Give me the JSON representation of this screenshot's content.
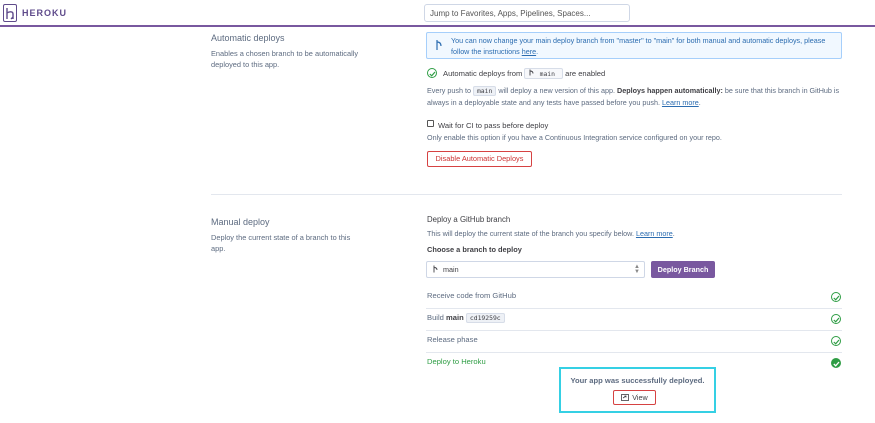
{
  "header": {
    "brand": "HEROKU",
    "search_placeholder": "Jump to Favorites, Apps, Pipelines, Spaces..."
  },
  "auto_deploys": {
    "title": "Automatic deploys",
    "description": "Enables a chosen branch to be automatically deployed to this app.",
    "banner": {
      "text": "You can now change your main deploy branch from \"master\" to \"main\" for both manual and automatic deploys, please follow the instructions",
      "link": "here",
      "end": "."
    },
    "status_prefix": "Automatic deploys from",
    "branch": "main",
    "status_suffix": "are enabled",
    "push_1": "Every push to",
    "push_branch": "main",
    "push_2": "will deploy a new version of this app.",
    "push_bold": "Deploys happen automatically:",
    "push_3": "be sure that this branch in GitHub is always in a deployable state and any tests have passed before you push.",
    "push_link": "Learn more",
    "push_end": ".",
    "ci_label": "Wait for CI to pass before deploy",
    "ci_desc": "Only enable this option if you have a Continuous Integration service configured on your repo.",
    "disable_button": "Disable Automatic Deploys"
  },
  "manual_deploy": {
    "title": "Manual deploy",
    "description": "Deploy the current state of a branch to this app.",
    "heading": "Deploy a GitHub branch",
    "sub": "This will deploy the current state of the branch you specify below.",
    "sub_link": "Learn more",
    "sub_end": ".",
    "choose_label": "Choose a branch to deploy",
    "selected_branch": "main",
    "deploy_button": "Deploy Branch",
    "steps": [
      {
        "label": "Receive code from GitHub"
      },
      {
        "label": "Build",
        "bold": "main",
        "code": "cd19259c"
      },
      {
        "label": "Release phase"
      },
      {
        "label": "Deploy to Heroku"
      }
    ],
    "success_message": "Your app was successfully deployed.",
    "view_button": "View"
  },
  "colors": {
    "brand_purple": "#79589f",
    "success_green": "#2e9d44",
    "danger_red": "#d64242",
    "link_blue": "#2b6cb0",
    "highlight_cyan": "#35d0e4"
  }
}
